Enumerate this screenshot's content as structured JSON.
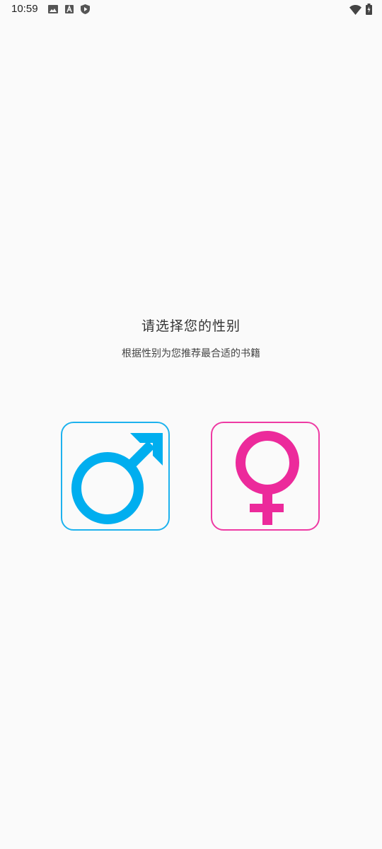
{
  "status_bar": {
    "time": "10:59",
    "icons_left": [
      "image-icon",
      "font-icon",
      "play-shield-icon"
    ],
    "icons_right": [
      "wifi-icon",
      "battery-icon"
    ]
  },
  "main": {
    "title": "请选择您的性别",
    "subtitle": "根据性别为您推荐最合适的书籍"
  },
  "options": {
    "male": {
      "icon": "male-symbol-icon",
      "color": "#00aeef"
    },
    "female": {
      "icon": "female-symbol-icon",
      "color": "#ec2a9b"
    }
  }
}
